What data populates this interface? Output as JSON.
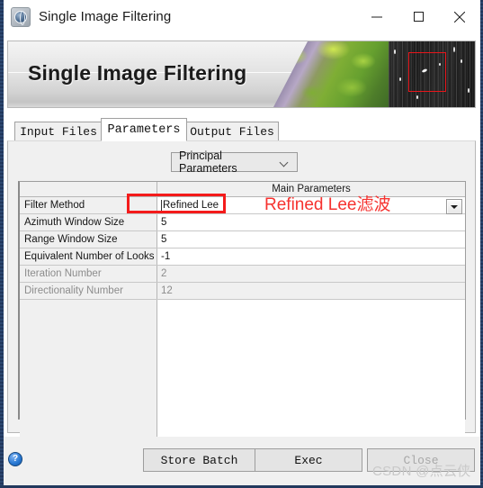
{
  "window": {
    "title": "Single Image Filtering",
    "icon": "globe-icon",
    "minimize_label": "minimize-icon",
    "maximize_label": "maximize-icon",
    "close_label": "close-icon"
  },
  "banner": {
    "title": "Single Image Filtering",
    "optical_image": "aerial-optical-thumbnail",
    "sar_image": "sar-radar-thumbnail",
    "sar_highlight_box_color": "#e8161b"
  },
  "tabs": [
    {
      "label": "Input Files",
      "active": false
    },
    {
      "label": "Parameters",
      "active": true
    },
    {
      "label": "Output Files",
      "active": false
    }
  ],
  "panel": {
    "parameter_set_selector": {
      "value": "Principal Parameters",
      "chevron": "chevron-down-icon"
    },
    "table": {
      "header": {
        "left": "",
        "right": "Main Parameters"
      },
      "rows": [
        {
          "label": "Filter Method",
          "value": "Refined Lee",
          "disabled": false,
          "has_dropdown": true
        },
        {
          "label": "Azimuth Window Size",
          "value": "5",
          "disabled": false,
          "has_dropdown": false
        },
        {
          "label": "Range Window Size",
          "value": "5",
          "disabled": false,
          "has_dropdown": false
        },
        {
          "label": "Equivalent Number of Looks",
          "value": "-1",
          "disabled": false,
          "has_dropdown": false
        },
        {
          "label": "Iteration Number",
          "value": "2",
          "disabled": true,
          "has_dropdown": false
        },
        {
          "label": "Directionality Number",
          "value": "12",
          "disabled": true,
          "has_dropdown": false
        }
      ]
    }
  },
  "annotations": {
    "highlight_box_color": "#f41b1b",
    "note_text": "Refined Lee滤波",
    "note_color": "#f6322f"
  },
  "footer": {
    "help_label": "?",
    "store_batch_label": "Store Batch",
    "exec_label": "Exec",
    "close_label": "Close"
  },
  "watermark": {
    "text": "CSDN @点云侠"
  }
}
